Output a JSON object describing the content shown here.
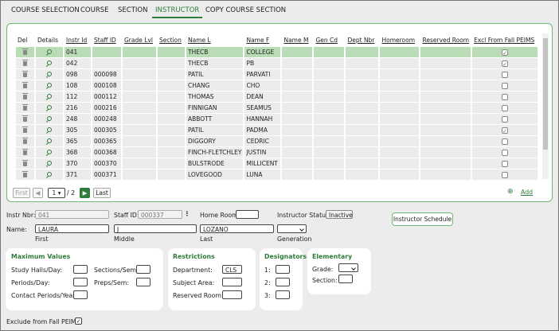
{
  "tabs": [
    "COURSE SELECTION",
    "COURSE",
    "SECTION",
    "INSTRUCTOR",
    "COPY COURSE SECTION"
  ],
  "columns": [
    "Del",
    "Details",
    "Instr Id",
    "Staff ID",
    "Grade Lvl",
    "Section",
    "Name L",
    "Name F",
    "Name M",
    "Gen Cd",
    "Dept Nbr",
    "Homeroom",
    "Reserved Room",
    "Excl From Fall PEIMS"
  ],
  "rows": [
    {
      "instr_id": "041",
      "staff_id": "",
      "name_l": "THECB",
      "name_f": "COLLEGE",
      "excl": true,
      "selected": true
    },
    {
      "instr_id": "042",
      "staff_id": "",
      "name_l": "THECB",
      "name_f": "PB",
      "excl": true,
      "selected": false
    },
    {
      "instr_id": "098",
      "staff_id": "000098",
      "name_l": "PATIL",
      "name_f": "PARVATI",
      "excl": false,
      "selected": false
    },
    {
      "instr_id": "108",
      "staff_id": "000108",
      "name_l": "CHANG",
      "name_f": "CHO",
      "excl": false,
      "selected": false
    },
    {
      "instr_id": "112",
      "staff_id": "000112",
      "name_l": "THOMAS",
      "name_f": "DEAN",
      "excl": false,
      "selected": false
    },
    {
      "instr_id": "216",
      "staff_id": "000216",
      "name_l": "FINNIGAN",
      "name_f": "SEAMUS",
      "excl": false,
      "selected": false
    },
    {
      "instr_id": "248",
      "staff_id": "000248",
      "name_l": "ABBOTT",
      "name_f": "HANNAH",
      "excl": false,
      "selected": false
    },
    {
      "instr_id": "305",
      "staff_id": "000305",
      "name_l": "PATIL",
      "name_f": "PADMA",
      "excl": true,
      "selected": false
    },
    {
      "instr_id": "365",
      "staff_id": "000365",
      "name_l": "DIGGORY",
      "name_f": "CEDRIC",
      "excl": false,
      "selected": false
    },
    {
      "instr_id": "368",
      "staff_id": "000368",
      "name_l": "FINCH-FLETCHLEY",
      "name_f": "JUSTIN",
      "excl": false,
      "selected": false
    },
    {
      "instr_id": "370",
      "staff_id": "000370",
      "name_l": "BULSTRODE",
      "name_f": "MILLICENT",
      "excl": false,
      "selected": false
    },
    {
      "instr_id": "371",
      "staff_id": "000371",
      "name_l": "LOVEGOOD",
      "name_f": "LUNA",
      "excl": false,
      "selected": false
    }
  ],
  "pager": {
    "first": "First",
    "page": "1",
    "of": "/ 2",
    "last": "Last",
    "add": "Add"
  },
  "form": {
    "instr_nbr_label": "Instr Nbr:",
    "instr_nbr": "041",
    "staff_id_label": "Staff ID:",
    "staff_id": "000337",
    "home_room_label": "Home Room:",
    "home_room": "",
    "instructor_status_label": "Instructor Status :",
    "instructor_status": "Inactive",
    "instructor_schedule_button": "Instructor Schedule",
    "name_label": "Name:",
    "first": "LAURA",
    "middle": "J",
    "last": "LOZANO",
    "first_label": "First",
    "middle_label": "Middle",
    "last_label": "Last",
    "generation_label": "Generation",
    "exclude_label": "Exclude from Fall PEIMS:"
  },
  "max_values": {
    "title": "Maximum Values",
    "study_halls": "Study Halls/Day:",
    "periods": "Periods/Day:",
    "contact_periods": "Contact Periods/Year:",
    "sections": "Sections/Sem:",
    "preps": "Preps/Sem:"
  },
  "restrictions": {
    "title": "Restrictions",
    "department": "Department:",
    "department_value": "CLS",
    "subject_area": "Subject Area:",
    "reserved_room": "Reserved Room:"
  },
  "designators": {
    "title": "Designators",
    "d1": "1:",
    "d2": "2:",
    "d3": "3:"
  },
  "elementary": {
    "title": "Elementary",
    "grade": "Grade:",
    "section": "Section:"
  }
}
